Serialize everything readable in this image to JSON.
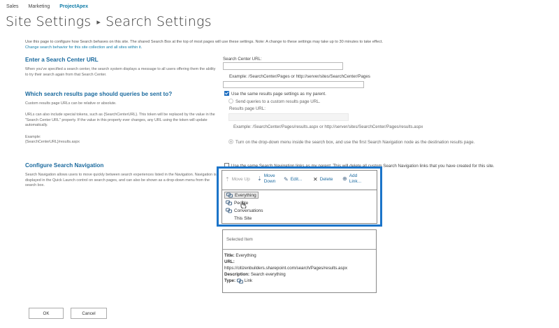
{
  "topnav": {
    "items": [
      "Sales",
      "Marketing",
      "ProjectApex"
    ]
  },
  "breadcrumb": {
    "parent": "Site Settings",
    "separator": "▸",
    "current": "Search Settings"
  },
  "intro": {
    "text": "Use this page to configure how Search behaves on this site. The shared Search Box at the top of most pages will use these settings. Note: A change to these settings may take up to 30 minutes to take effect.",
    "link": "Change search behavior for this site collection and all sites within it."
  },
  "search_center": {
    "heading": "Enter a Search Center URL",
    "description": "When you've specified a search center, the search system displays a message to all users offering them the ability to try their search again from that Search Center.",
    "field_label": "Search Center URL:",
    "field_value": "",
    "example": "Example: /SearchCenter/Pages or http://server/sites/SearchCenter/Pages"
  },
  "results_page": {
    "heading": "Which search results page should queries be sent to?",
    "desc1": "Custom results page URLs can be relative or absolute.",
    "desc2": "URLs can also include special tokens, such as {SearchCenterURL}. This token will be replaced by the value in the \"Search Center URL\" property. If the value in this property ever changes, any URL using the token will update automatically.",
    "example_label": "Example:",
    "example_value": "{SearchCenterURL}/results.aspx",
    "use_same_label": "Use the same results page settings as my parent.",
    "use_same_checked": true,
    "send_custom_label": "Send queries to a custom results page URL.",
    "results_url_label": "Results page URL:",
    "results_url_value": "",
    "results_example": "Example: /SearchCenter/Pages/results.aspx or http://server/sites/SearchCenter/Pages/results.aspx",
    "dropdown_label": "Turn on the drop-down menu inside the search box, and use the first Search Navigation node as the destination results page."
  },
  "search_nav": {
    "heading": "Configure Search Navigation",
    "description": "Search Navigation allows users to move quickly between search experiences listed in the Navigation. Navigation is displayed in the Quick Launch control on search pages, and can also be shown as a drop-down menu from the search box.",
    "use_parent_label": "Use the same Search Navigation links as my parent. This will delete all custom Search Navigation links that you have created for this site.",
    "use_parent_checked": false,
    "toolbar": {
      "move_up": "Move Up",
      "move_down": "Move Down",
      "edit": "Edit...",
      "delete": "Delete",
      "add_link": "Add Link..."
    },
    "items": [
      "Everything",
      "People",
      "Conversations",
      "This Site"
    ],
    "selected_index": 0
  },
  "selected_item": {
    "header": "Selected Item",
    "title_label": "Title:",
    "title_value": "Everything",
    "url_label": "URL:",
    "url_value": "https://citizenbuilders.sharepoint.com/search/Pages/results.aspx",
    "description_label": "Description:",
    "description_value": "Search everything",
    "type_label": "Type:",
    "type_value": "Link"
  },
  "buttons": {
    "ok": "OK",
    "cancel": "Cancel"
  },
  "colors": {
    "accent": "#1b6a9e",
    "highlight_border": "#1b74c9",
    "checkbox": "#1e6ec0"
  }
}
